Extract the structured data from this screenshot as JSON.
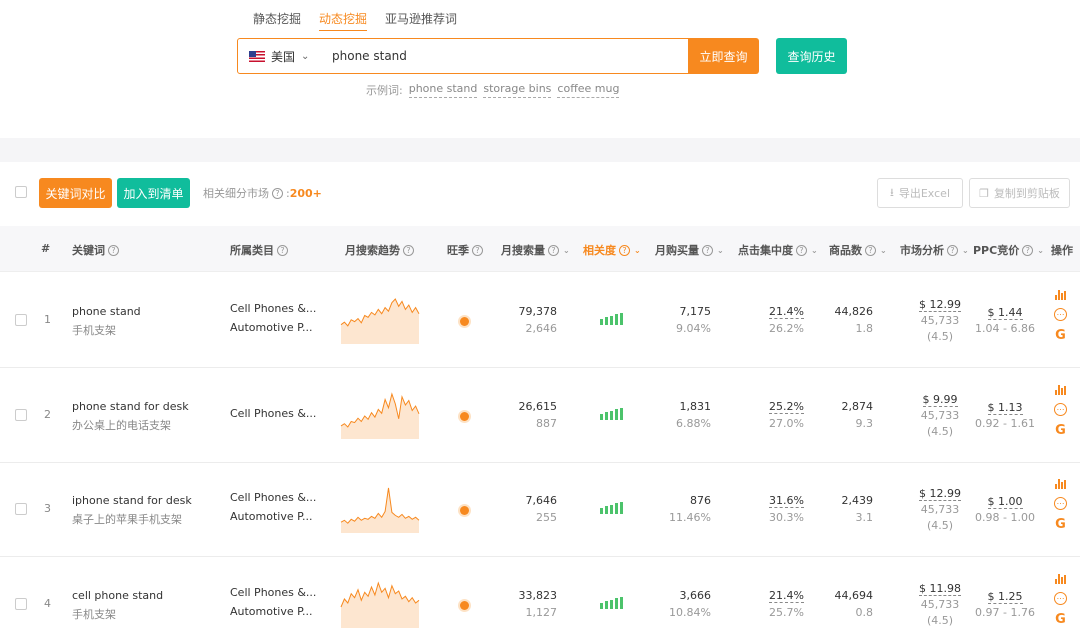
{
  "mode_tabs": [
    "静态挖掘",
    "动态挖掘",
    "亚马逊推荐词"
  ],
  "search": {
    "market": "美国",
    "query": "phone stand",
    "submit_label": "立即查询",
    "history_label": "查询历史",
    "examples_label": "示例词:",
    "examples": [
      "phone stand",
      "storage bins",
      "coffee mug"
    ]
  },
  "toolbar": {
    "compare_label": "关键词对比",
    "add_label": "加入到清单",
    "related_label": "相关细分市场",
    "related_count": "200+",
    "export_label": "导出Excel",
    "copy_label": "复制到剪贴板"
  },
  "columns": [
    "#",
    "关键词",
    "所属类目",
    "月搜索趋势",
    "旺季",
    "月搜索量",
    "相关度",
    "月购买量",
    "点击集中度",
    "商品数",
    "市场分析",
    "PPC竞价",
    "操作"
  ],
  "colors": {
    "accent": "#f7891f",
    "green": "#10bd9c",
    "bar_green": "#4cc36b"
  },
  "rows": [
    {
      "index": "1",
      "keyword": "phone stand",
      "keyword_cn": "手机支架",
      "category": [
        "Cell Phones &...",
        "Automotive P..."
      ],
      "trend": [
        30,
        34,
        28,
        38,
        35,
        40,
        33,
        45,
        42,
        50,
        46,
        55,
        48,
        58,
        52,
        66,
        72,
        60,
        68,
        55,
        62,
        50,
        58,
        48
      ],
      "search_volume": "79,378",
      "search_sub": "2,646",
      "relevance": 5,
      "purchases": "7,175",
      "purchase_rate": "9.04%",
      "click_conc": "21.4%",
      "click_sub": "26.2%",
      "products": "44,826",
      "products_sub": "1.8",
      "price": "$ 12.99",
      "reviews": "45,733",
      "rating": "(4.5)",
      "ppc": "$ 1.44",
      "ppc_range": "1.04 - 6.86"
    },
    {
      "index": "2",
      "keyword": "phone stand for desk",
      "keyword_cn": "办公桌上的电话支架",
      "category": [
        "Cell Phones &..."
      ],
      "trend": [
        22,
        26,
        20,
        30,
        28,
        36,
        30,
        40,
        34,
        46,
        38,
        52,
        45,
        70,
        55,
        80,
        62,
        35,
        75,
        60,
        68,
        50,
        58,
        44
      ],
      "search_volume": "26,615",
      "search_sub": "887",
      "relevance": 5,
      "purchases": "1,831",
      "purchase_rate": "6.88%",
      "click_conc": "25.2%",
      "click_sub": "27.0%",
      "products": "2,874",
      "products_sub": "9.3",
      "price": "$ 9.99",
      "reviews": "45,733",
      "rating": "(4.5)",
      "ppc": "$ 1.13",
      "ppc_range": "0.92 - 1.61"
    },
    {
      "index": "3",
      "keyword": "iphone stand for desk",
      "keyword_cn": "桌子上的苹果手机支架",
      "category": [
        "Cell Phones &...",
        "Automotive P..."
      ],
      "trend": [
        20,
        24,
        18,
        26,
        22,
        30,
        24,
        28,
        26,
        32,
        28,
        38,
        30,
        42,
        90,
        40,
        34,
        30,
        36,
        28,
        32,
        26,
        30,
        24
      ],
      "search_volume": "7,646",
      "search_sub": "255",
      "relevance": 5,
      "purchases": "876",
      "purchase_rate": "11.46%",
      "click_conc": "31.6%",
      "click_sub": "30.3%",
      "products": "2,439",
      "products_sub": "3.1",
      "price": "$ 12.99",
      "reviews": "45,733",
      "rating": "(4.5)",
      "ppc": "$ 1.00",
      "ppc_range": "0.98 - 1.00"
    },
    {
      "index": "4",
      "keyword": "cell phone stand",
      "keyword_cn": "手机支架",
      "category": [
        "Cell Phones &...",
        "Automotive P..."
      ],
      "trend": [
        30,
        42,
        36,
        50,
        44,
        56,
        40,
        52,
        46,
        60,
        48,
        66,
        52,
        58,
        44,
        62,
        50,
        54,
        42,
        46,
        38,
        44,
        36,
        40
      ],
      "search_volume": "33,823",
      "search_sub": "1,127",
      "relevance": 5,
      "purchases": "3,666",
      "purchase_rate": "10.84%",
      "click_conc": "21.4%",
      "click_sub": "25.7%",
      "products": "44,694",
      "products_sub": "0.8",
      "price": "$ 11.98",
      "reviews": "45,733",
      "rating": "(4.5)",
      "ppc": "$ 1.25",
      "ppc_range": "0.97 - 1.76"
    }
  ]
}
